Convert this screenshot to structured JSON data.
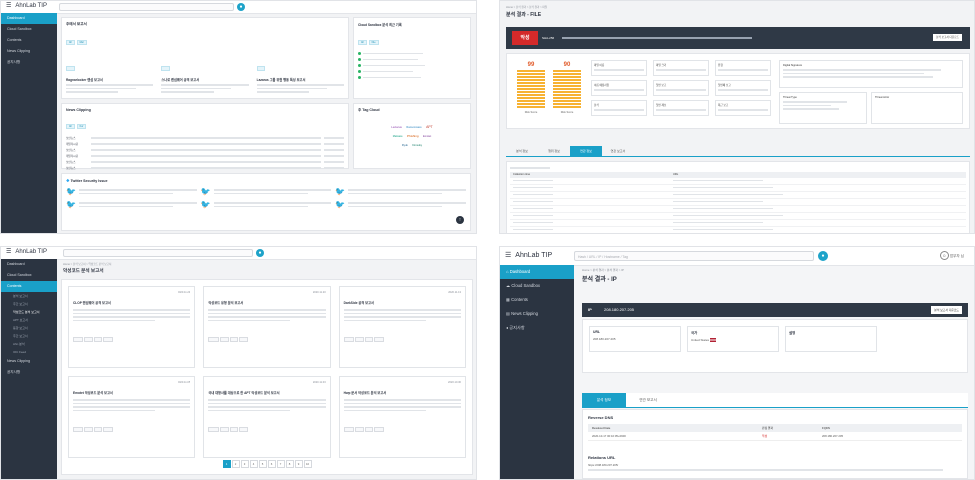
{
  "app": {
    "brand": "AhnLab TIP",
    "menu_icon": "hamburger-icon",
    "search_icon": "magnifier-icon"
  },
  "panel1": {
    "sidebar": [
      "Dashboard",
      "Cloud Sandbox",
      "Contents",
      "News Clipping",
      "공지사항"
    ],
    "cards": {
      "reports": "주에서 보고서",
      "sandbox": "Cloud Sandbox 분석 최근 기록",
      "news": "News Clipping",
      "topics": "주 Tag Cloud",
      "twitter": "Twitter Security Issue"
    },
    "report_titles": [
      "Ragnarlocker 랜섬 보고서",
      "스나로 랜섬웨어 공격 보고서",
      "Lazarus 그룹 위협 행동 특성 보고서"
    ],
    "news_sources": [
      "보안뉴스",
      "데일리시큐",
      "보안뉴스",
      "데일리시큐",
      "보안뉴스",
      "보안뉴스"
    ],
    "tags": [
      "Lazarus",
      "Ransomware",
      "APT",
      "Malware",
      "Phishing",
      "Emotet",
      "Ryuk",
      "Kimsuky"
    ]
  },
  "panel2": {
    "breadcrumb": "Home > 분석 결과 > 분석 결과 > 파일",
    "title": "분석 결과 - FILE",
    "verdict": "악성",
    "hash_type": "SHA-256",
    "scores": [
      "99",
      "90"
    ],
    "score_labels": [
      "Risk Score",
      "Risk Score"
    ],
    "fields": [
      "파일 이름",
      "파일 크기",
      "유형",
      "이름 예정사항",
      "첫번 보고",
      "첫번째 보고",
      "분석",
      "첫번 제보",
      "최근 보고"
    ],
    "signature_title": "Digital Signature",
    "threat_title": "Threat Type",
    "threat_actor": "Threat Actor",
    "tabs": [
      "분석 정보",
      "행위 정보",
      "연관 정보",
      "연관 보고서"
    ],
    "table_headers": [
      "Collection time",
      "URL"
    ],
    "download_btn": "분석 보고서 다운로드"
  },
  "panel3": {
    "breadcrumb": "Home > 분석 보고서 > 악성코드 분석 보고서",
    "title": "악성코드 분석 보고서",
    "sidebar": [
      "Dashboard",
      "Cloud Sandbox",
      "Contents",
      "분석 보고서",
      "주간 보고서",
      "악성코드 분석 보고서",
      "APT 보고서",
      "동향 보고서",
      "주간 보고서",
      "Ahn 분석",
      "IOC Feed",
      "News Clipping",
      "공지사항"
    ],
    "cards": [
      {
        "title": "CLOP 랜섬웨어 공격 보고서",
        "date": "2020.11.24"
      },
      {
        "title": "악성코드 유형 분석 보고서",
        "date": "2020.11.20"
      },
      {
        "title": "DarkSide 공격 보고서",
        "date": "2020.11.13"
      },
      {
        "title": "Emotet 악성코드 분석 보고서",
        "date": "2020.11.05"
      },
      {
        "title": "국내 대형사를 대상으로 한 APT 악성코드 분석 보고서",
        "date": "2020.11.03"
      },
      {
        "title": "Hwp 문서 악성코드 분석 보고서",
        "date": "2020.10.30"
      }
    ],
    "pagination": [
      "1",
      "2",
      "3",
      "4",
      "5",
      "6",
      "7",
      "8",
      "9",
      "10"
    ]
  },
  "panel4": {
    "brand": "AhnLab TIP",
    "search_placeholder": "Hash / URL / IP / Hostname / Tag",
    "user": "업무자 님",
    "sidebar": [
      "Dashboard",
      "Cloud Sandbox",
      "Contents",
      "News Clipping",
      "공지사항"
    ],
    "breadcrumb": "Home > 분석 결과 > 분석 결과 > IP",
    "title": "분석 결과 - IP",
    "ip_label": "IP",
    "ip_value": "208.180.207.205",
    "download_btn": "분석 보고서 다운로드",
    "url_label": "URL",
    "url_value": "208.180.207.205",
    "country_label": "국가",
    "country_value": "United States",
    "status_label": "설명",
    "tabs": [
      "분석 정보",
      "연관 보고서"
    ],
    "reverse_dns": "Reverse DNS",
    "table_headers": [
      "Resolved Date",
      "판정 결과",
      "FQDN"
    ],
    "row": {
      "date": "2020-10-17 00:10:05+0900",
      "verdict": "악성",
      "fqdn": "208.180.207.205"
    },
    "relations_url": "Relations URL",
    "relation_link": "https://208.180.207.205/"
  }
}
